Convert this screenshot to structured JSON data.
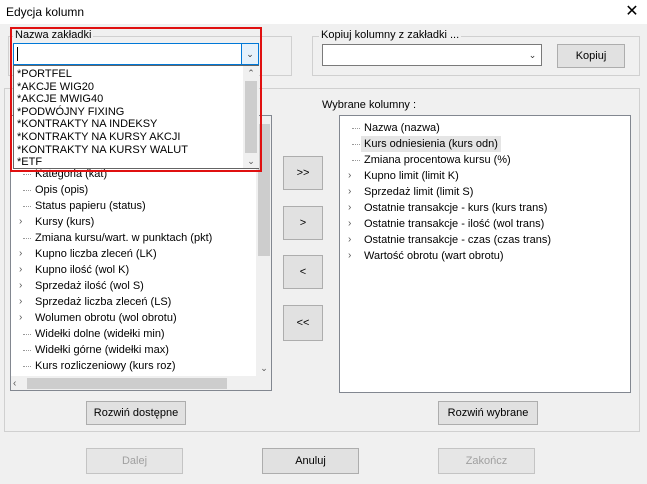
{
  "window": {
    "title": "Edycja kolumn",
    "close_glyph": "✕"
  },
  "tab_name": {
    "label": "Nazwa zakładki",
    "value": ""
  },
  "copy_columns": {
    "label": "Kopiuj kolumny z zakładki ...",
    "value": "",
    "button": "Kopiuj"
  },
  "selected_label": "Wybrane kolumny :",
  "dropdown_items": [
    "*PORTFEL",
    "*AKCJE WIG20",
    "*AKCJE MWIG40",
    "*PODWÓJNY FIXING",
    "*KONTRAKTY NA INDEKSY",
    "*KONTRAKTY NA KURSY AKCJI",
    "*KONTRAKTY NA KURSY WALUT",
    "*ETF"
  ],
  "available_items": [
    {
      "label": "Kategoria (kat)",
      "expandable": false
    },
    {
      "label": "Opis (opis)",
      "expandable": false
    },
    {
      "label": "Status papieru (status)",
      "expandable": false
    },
    {
      "label": "Kursy (kurs)",
      "expandable": true
    },
    {
      "label": "Zmiana kursu/wart. w punktach (pkt)",
      "expandable": false
    },
    {
      "label": "Kupno liczba zleceń (LK)",
      "expandable": true
    },
    {
      "label": "Kupno ilość (wol K)",
      "expandable": true
    },
    {
      "label": "Sprzedaż ilość (wol S)",
      "expandable": true
    },
    {
      "label": "Sprzedaż liczba zleceń (LS)",
      "expandable": true
    },
    {
      "label": "Wolumen obrotu (wol obrotu)",
      "expandable": true
    },
    {
      "label": "Widełki dolne (widełki min)",
      "expandable": false
    },
    {
      "label": "Widełki górne (widełki max)",
      "expandable": false
    },
    {
      "label": "Kurs rozliczeniowy (kurs roz)",
      "expandable": false
    }
  ],
  "selected_items": [
    {
      "label": "Nazwa (nazwa)",
      "expandable": false,
      "selected": false
    },
    {
      "label": "Kurs odniesienia (kurs odn)",
      "expandable": false,
      "selected": true
    },
    {
      "label": "Zmiana procentowa kursu (%)",
      "expandable": false,
      "selected": false
    },
    {
      "label": "Kupno limit (limit K)",
      "expandable": true,
      "selected": false
    },
    {
      "label": "Sprzedaż limit (limit S)",
      "expandable": true,
      "selected": false
    },
    {
      "label": "Ostatnie transakcje - kurs (kurs trans)",
      "expandable": true,
      "selected": false
    },
    {
      "label": "Ostatnie transakcje - ilość (wol trans)",
      "expandable": true,
      "selected": false
    },
    {
      "label": "Ostatnie transakcje - czas (czas trans)",
      "expandable": true,
      "selected": false
    },
    {
      "label": "Wartość obrotu (wart obrotu)",
      "expandable": true,
      "selected": false
    }
  ],
  "move_buttons": {
    "add_all": ">>",
    "add": ">",
    "remove": "<",
    "remove_all": "<<"
  },
  "expand_available": "Rozwiń dostępne",
  "expand_selected": "Rozwiń wybrane",
  "footer": {
    "next": "Dalej",
    "cancel": "Anuluj",
    "finish": "Zakończ"
  }
}
